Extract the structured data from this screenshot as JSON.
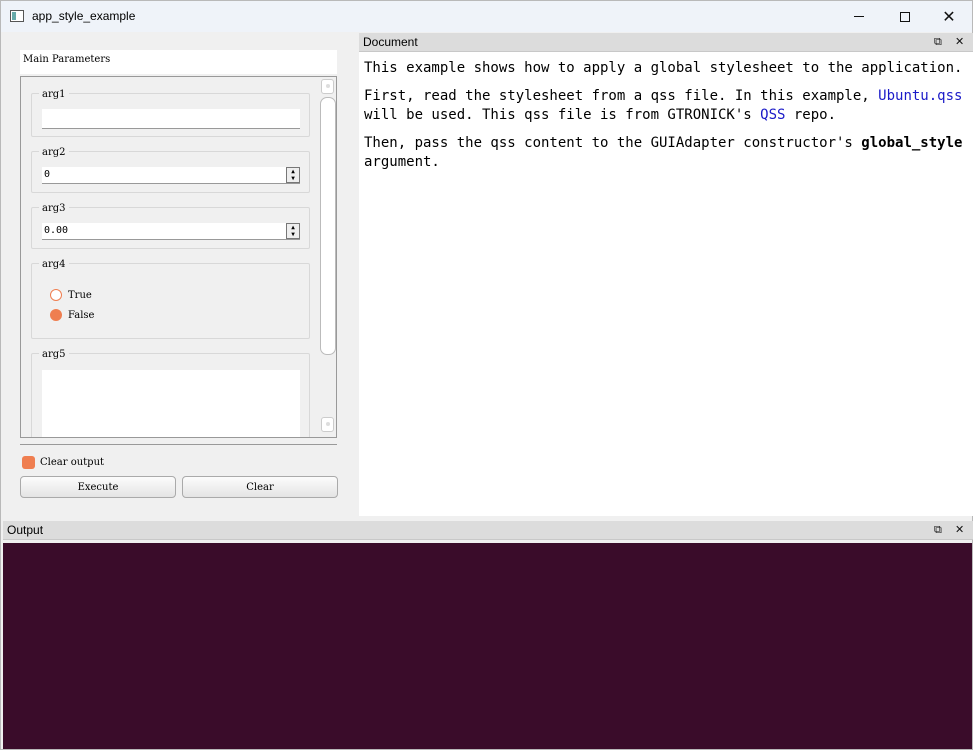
{
  "window": {
    "title": "app_style_example",
    "controls": {
      "minimize": "—",
      "maximize": "☐",
      "close": "✕"
    }
  },
  "params": {
    "header": "Main Parameters",
    "arg1": {
      "label": "arg1",
      "value": ""
    },
    "arg2": {
      "label": "arg2",
      "value": "0"
    },
    "arg3": {
      "label": "arg3",
      "value": "0.00"
    },
    "arg4": {
      "label": "arg4",
      "options": [
        "True",
        "False"
      ],
      "selected": "False"
    },
    "arg5": {
      "label": "arg5",
      "value": ""
    }
  },
  "bottom": {
    "clear_output_label": "Clear output",
    "clear_output_checked": true,
    "execute_label": "Execute",
    "clear_label": "Clear"
  },
  "document": {
    "title": "Document",
    "p1": "This example shows how to apply a global stylesheet to the application.",
    "p2_a": "First, read the stylesheet from a qss file. In this example, ",
    "p2_link1": "Ubuntu.qss",
    "p2_b": " will be used. This qss file is from GTRONICK's ",
    "p2_link2": "QSS",
    "p2_c": " repo.",
    "p3_a": "Then, pass the qss content to the GUIAdapter constructor's ",
    "p3_bold": "global_style",
    "p3_b": " argument."
  },
  "output": {
    "title": "Output"
  },
  "colors": {
    "accent": "#ef7e50",
    "output_bg": "#3a0c2a",
    "link": "#1a1ac8"
  },
  "icons": {
    "float": "restore-icon",
    "close": "close-icon"
  }
}
